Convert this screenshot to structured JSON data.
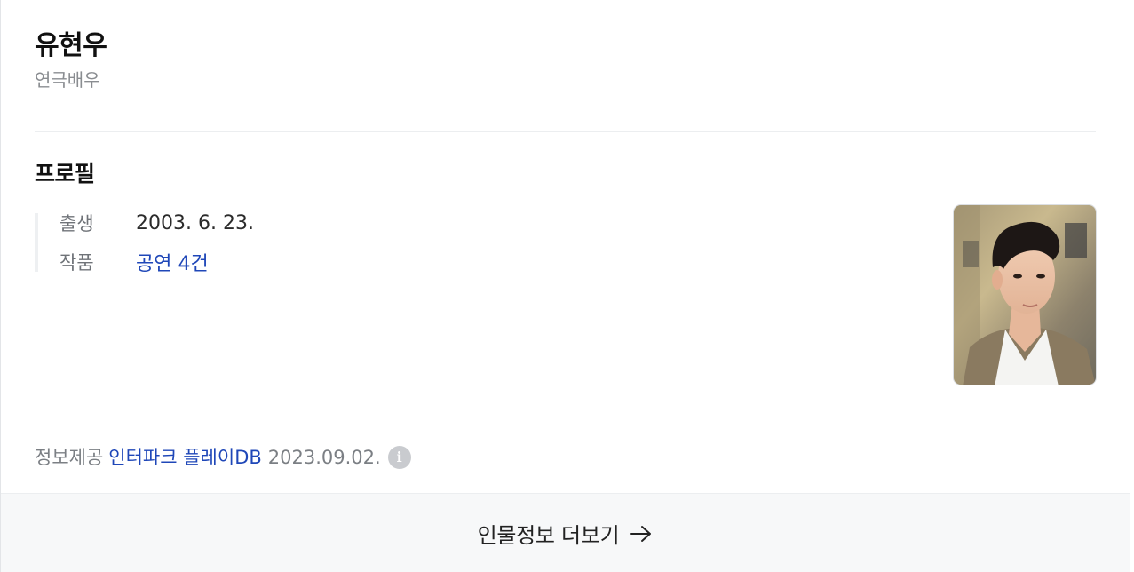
{
  "person": {
    "name": "유현우",
    "occupation": "연극배우"
  },
  "profile": {
    "section_title": "프로필",
    "rows": [
      {
        "label": "출생",
        "value": "2003. 6. 23."
      },
      {
        "label": "작품",
        "value": "공연 4건"
      }
    ]
  },
  "source": {
    "prefix": "정보제공",
    "provider": "인터파크 플레이DB",
    "date": "2023.09.02.",
    "info_icon": "info-icon",
    "info_glyph": "i"
  },
  "more": {
    "label": "인물정보 더보기",
    "icon": "arrow-right-icon"
  },
  "colors": {
    "link": "#1f47b8",
    "muted": "#8a8d91",
    "divider": "#eceef0",
    "footer_bg": "#f7f8f9"
  }
}
